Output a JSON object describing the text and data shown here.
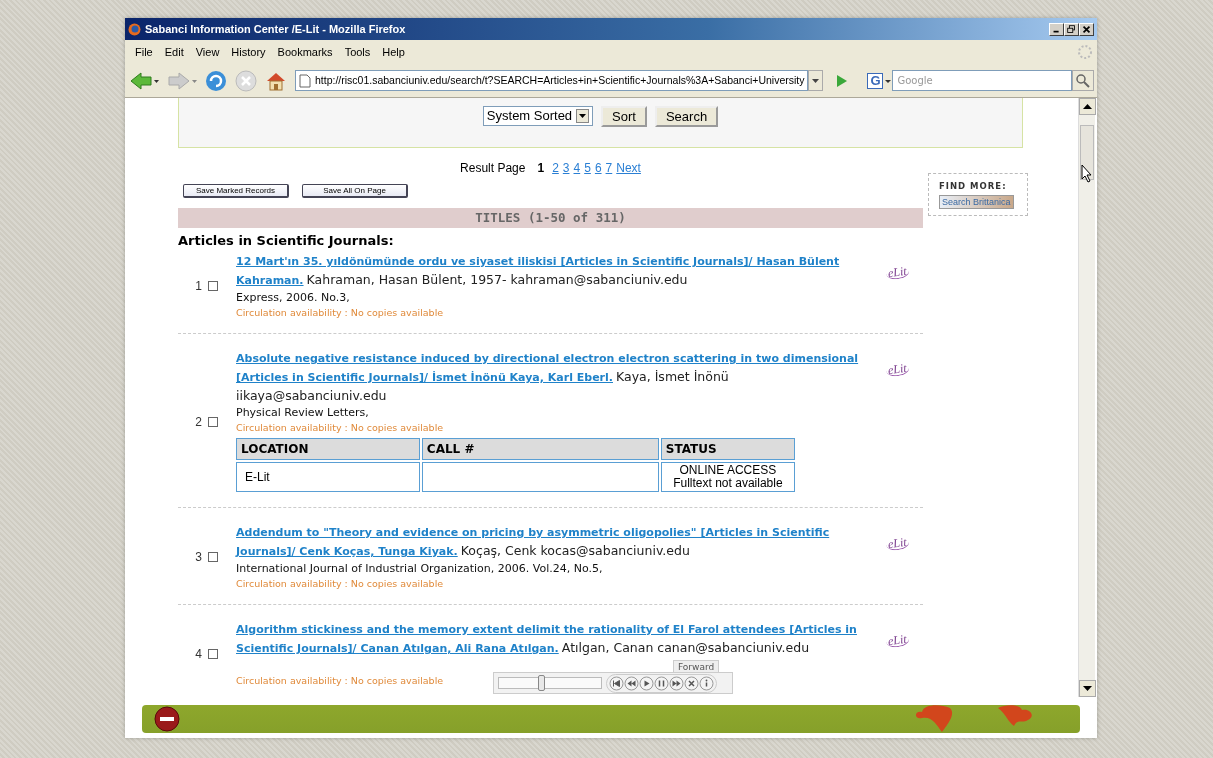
{
  "window": {
    "title": "Sabanci Information Center /E-Lit - Mozilla Firefox"
  },
  "menu": [
    {
      "label": "File"
    },
    {
      "label": "Edit"
    },
    {
      "label": "View"
    },
    {
      "label": "History"
    },
    {
      "label": "Bookmarks"
    },
    {
      "label": "Tools"
    },
    {
      "label": "Help"
    }
  ],
  "address_bar": {
    "url": "http://risc01.sabanciuniv.edu/search/t?SEARCH=Articles+in+Scientific+Journals%3A+Sabanci+University"
  },
  "search": {
    "engine": "G",
    "placeholder": "Google"
  },
  "sort_form": {
    "sort_option": "System Sorted",
    "buttons": [
      "Sort",
      "Search"
    ]
  },
  "pager": {
    "label": "Result Page",
    "pages": [
      {
        "label": "1",
        "selected": true
      },
      {
        "label": "2",
        "selected": false
      },
      {
        "label": "3",
        "selected": false
      },
      {
        "label": "4",
        "selected": false
      },
      {
        "label": "5",
        "selected": false
      },
      {
        "label": "6",
        "selected": false
      },
      {
        "label": "7",
        "selected": false
      }
    ],
    "next": "Next"
  },
  "save_buttons": [
    "Save Marked Records",
    "Save All On Page"
  ],
  "titles_bar": "TITLES (1-50 of 311)",
  "find_more": {
    "heading": "FIND MORE:",
    "link": "Search Brittanica"
  },
  "section_heading": "Articles in Scientific Journals:",
  "records": [
    {
      "number": "1",
      "checked": false,
      "title": "12 Mart'ın 35. yıldönümünde ordu ve siyaset iliskisi [Articles in Scientific Journals]/ Hasan Bülent Kahraman.",
      "author": "Kahraman, Hasan Bülent, 1957- kahraman@sabanciuniv.edu",
      "lines": [
        "Express, 2006. No.3,"
      ],
      "circulation": "Circulation availability : No copies available",
      "logo": "eLit"
    },
    {
      "number": "2",
      "checked": false,
      "title": "Absolute negative resistance induced by directional electron electron scattering in two dimensional [Articles in Scientific Journals]/ İsmet İnönü Kaya, Karl Eberl.",
      "author": "Kaya, İsmet İnönü iikaya@sabanciuniv.edu",
      "lines": [
        "Physical Review Letters,"
      ],
      "circulation": "Circulation availability : No copies available",
      "logo": "eLit",
      "holdings": {
        "columns": [
          "LOCATION",
          "CALL #",
          "STATUS"
        ],
        "rows": [
          {
            "location": "E-Lit",
            "status": [
              "ONLINE ACCESS",
              "Fulltext not available"
            ]
          }
        ]
      }
    },
    {
      "number": "3",
      "checked": false,
      "title": "Addendum to \"Theory and evidence on pricing by asymmetric oligopolies\" [Articles in Scientific Journals]/ Cenk Koças, Tunga Kiyak.",
      "author": "Koçaş, Cenk kocas@sabanciuniv.edu",
      "lines": [
        "International Journal of Industrial Organization, 2006. Vol.24, No.5,"
      ],
      "circulation": "Circulation availability : No copies available",
      "logo": "eLit"
    },
    {
      "number": "4",
      "checked": false,
      "title": "Algorithm stickiness and the memory extent delimit the rationality of El Farol attendees [Articles in Scientific Journals]/ Canan Atılgan, Ali Rana Atılgan.",
      "author": "Atılgan, Canan canan@sabanciuniv.edu",
      "circulation": "Circulation availability : No copies available",
      "logo": "eLit"
    }
  ],
  "media_player": {
    "level": 0.42,
    "tooltip": "Forward"
  }
}
